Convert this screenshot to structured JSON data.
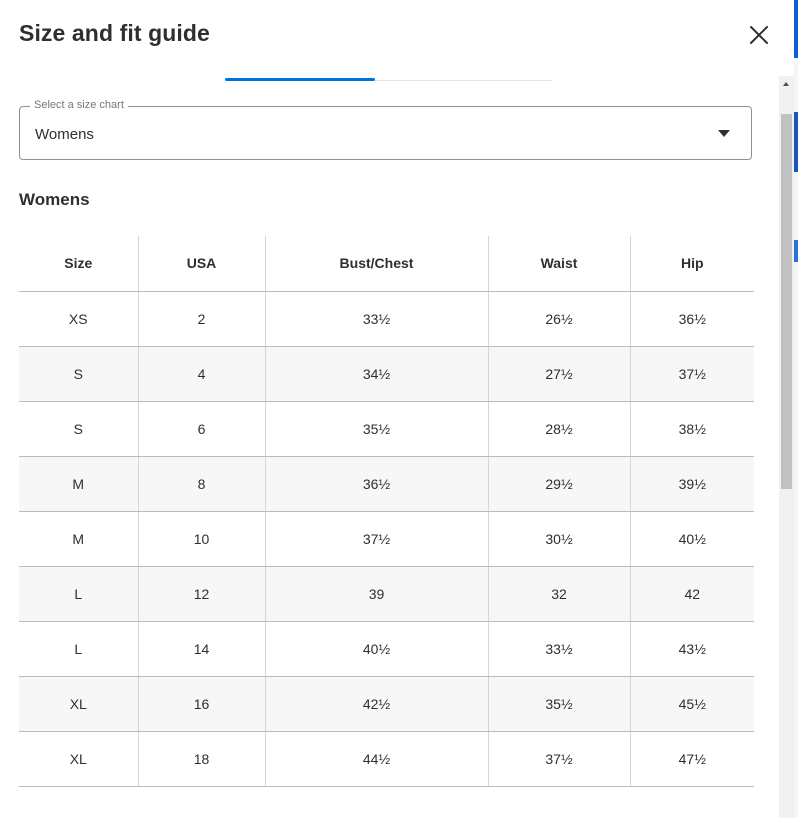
{
  "modal": {
    "title": "Size and fit guide"
  },
  "size_chart_select": {
    "legend": "Select a size chart",
    "value": "Womens"
  },
  "section": {
    "heading": "Womens"
  },
  "table": {
    "headers": [
      "Size",
      "USA",
      "Bust/Chest",
      "Waist",
      "Hip"
    ],
    "rows": [
      [
        "XS",
        "2",
        "33½",
        "26½",
        "36½"
      ],
      [
        "S",
        "4",
        "34½",
        "27½",
        "37½"
      ],
      [
        "S",
        "6",
        "35½",
        "28½",
        "38½"
      ],
      [
        "M",
        "8",
        "36½",
        "29½",
        "39½"
      ],
      [
        "M",
        "10",
        "37½",
        "30½",
        "40½"
      ],
      [
        "L",
        "12",
        "39",
        "32",
        "42"
      ],
      [
        "L",
        "14",
        "40½",
        "33½",
        "43½"
      ],
      [
        "XL",
        "16",
        "42½",
        "35½",
        "45½"
      ],
      [
        "XL",
        "18",
        "44½",
        "37½",
        "47½"
      ]
    ]
  },
  "icons": {
    "close": "close-icon",
    "dropdown": "chevron-down-icon",
    "scroll_up": "scroll-up-arrow-icon"
  },
  "colors": {
    "accent": "#0071dc",
    "text": "#2e2f32",
    "row_stripe": "#f7f7f7"
  }
}
